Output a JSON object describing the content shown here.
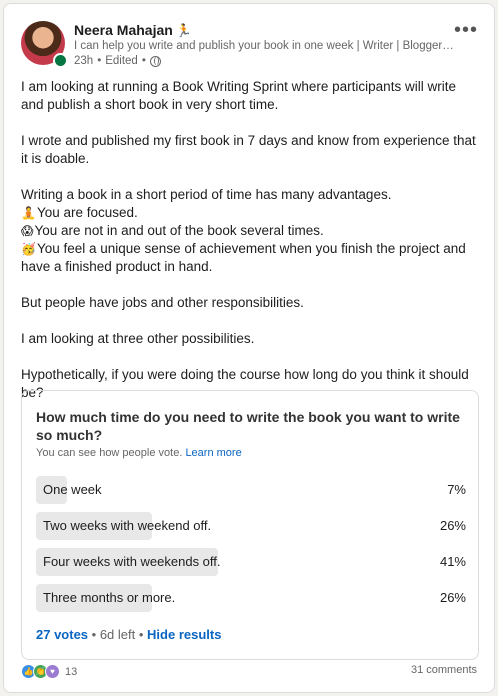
{
  "author": {
    "name": "Neera Mahajan",
    "name_emoji": "🏃",
    "headline": "I can help you write and publish your book in one week | Writer | Blogger | A...",
    "time": "23h",
    "edited": "Edited",
    "visibility_icon": "globe-icon",
    "avatar_icon": "profile-photo"
  },
  "menu": {
    "more_label": "•••"
  },
  "body": {
    "p1": "I am looking at running a Book Writing Sprint where participants will write and publish a short book in very short time.",
    "p2": "I wrote and published my first book in 7 days and know from experience that it is doable.",
    "p3_intro": "Writing a book in a short period of time has many advantages.",
    "adv1_emoji": "🧘",
    "adv1": "You are focused.",
    "adv2_emoji": "😱",
    "adv2": "You are not in and out of the book several times.",
    "adv3_emoji": "🥳",
    "adv3": "You feel a unique sense of achievement when you finish the project and have a finished product in hand.",
    "p4": "But people have jobs and other responsibilities.",
    "p5": "I am looking at three other possibilities.",
    "p6": "Hypothetically, if you were doing the course how long do you think it should be?"
  },
  "poll": {
    "question": "How much time do you need to write the book you want to write so much?",
    "note": "You can see how people vote.",
    "learn_more": "Learn more",
    "options": [
      {
        "label": "One week",
        "percent_text": "7%",
        "percent": 7
      },
      {
        "label": "Two weeks with weekend off.",
        "percent_text": "26%",
        "percent": 26
      },
      {
        "label": "Four weeks with weekends off.",
        "percent_text": "41%",
        "percent": 41
      },
      {
        "label": "Three months or more.",
        "percent_text": "26%",
        "percent": 26
      }
    ],
    "votes": "27 votes",
    "separator": " • ",
    "time_left": "6d left",
    "hide_results": "Hide results"
  },
  "social": {
    "reaction_icons": [
      "like-icon",
      "celebrate-icon",
      "support-icon"
    ],
    "reaction_count": "13",
    "comments": "31 comments"
  },
  "colors": {
    "link": "#0a66c2",
    "bar": "#e8e8e8",
    "presence": "#057642"
  }
}
